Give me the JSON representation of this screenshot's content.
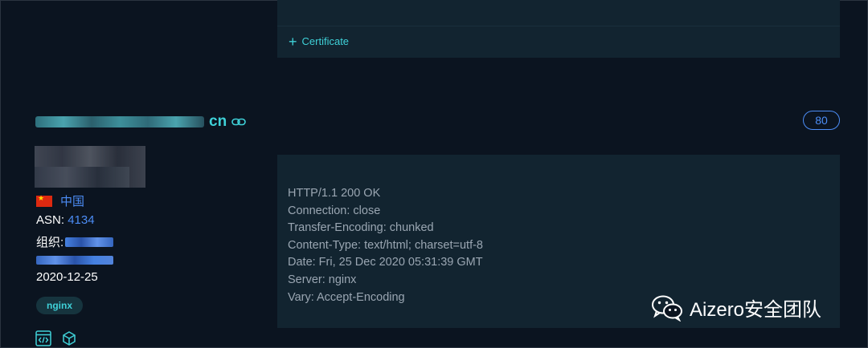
{
  "certificate_section": {
    "expand_label": "Certificate"
  },
  "host": {
    "domain_suffix": "cn"
  },
  "location": {
    "country": "中国"
  },
  "asn": {
    "label": "ASN: ",
    "value": "4134"
  },
  "org": {
    "label": "组织: "
  },
  "date": "2020-12-25",
  "tag": "nginx",
  "port": "80",
  "response": {
    "lines": [
      "HTTP/1.1 200 OK",
      "Connection: close",
      "Transfer-Encoding: chunked",
      "Content-Type: text/html; charset=utf-8",
      "Date: Fri, 25 Dec 2020 05:31:39 GMT",
      "Server: nginx",
      "Vary: Accept-Encoding"
    ]
  },
  "watermark": "Aizero安全团队",
  "colors": {
    "accent_cyan": "#3fd1d8",
    "accent_blue": "#4c8df6",
    "card_bg": "#122430",
    "page_bg": "#0b1420"
  },
  "icons": [
    "plus-icon",
    "link-icon",
    "china-flag-icon",
    "code-icon",
    "cube-icon",
    "wechat-icon"
  ]
}
